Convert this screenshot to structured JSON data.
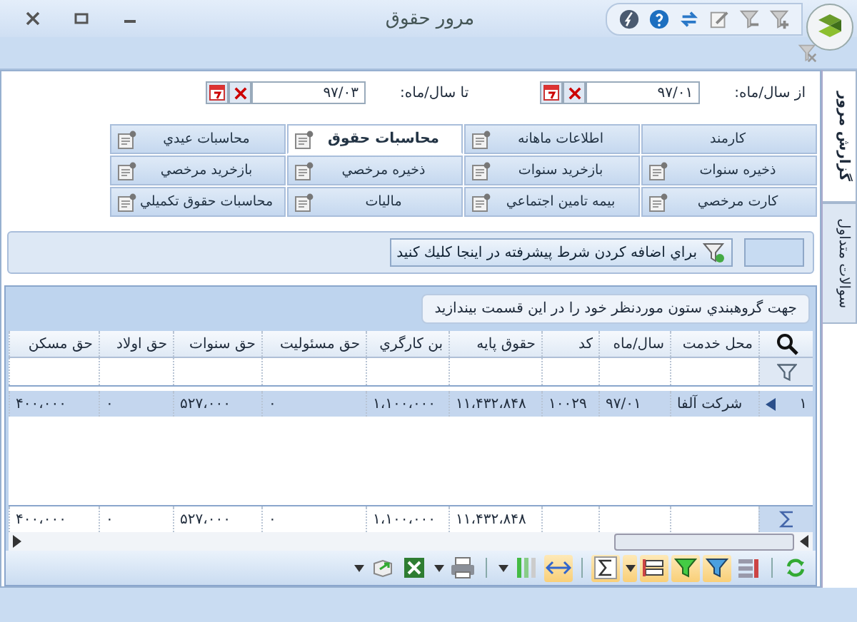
{
  "window": {
    "title": "مرور حقوق"
  },
  "title_toolbar": [
    {
      "kind": "flash"
    },
    {
      "kind": "help"
    },
    {
      "kind": "sync"
    },
    {
      "kind": "edit"
    },
    {
      "kind": "filter-remove"
    },
    {
      "kind": "filter-add"
    }
  ],
  "side_tabs": [
    {
      "label": "گزارش مرور",
      "selected": true
    },
    {
      "label": "سوالات متداول",
      "selected": false
    }
  ],
  "period": {
    "from_label": "از سال/ماه:",
    "from_value": "۹۷/۰۱",
    "to_label": "تا سال/ماه:",
    "to_value": "۹۷/۰۳"
  },
  "report_tabs": [
    {
      "label": "کارمند",
      "selected": false,
      "has_icon": false
    },
    {
      "label": "اطلاعات ماهانه",
      "selected": false,
      "has_icon": true
    },
    {
      "label": "محاسبات حقوق",
      "selected": true,
      "has_icon": true
    },
    {
      "label": "محاسبات عيدي",
      "selected": false,
      "has_icon": true
    },
    {
      "label": "ذخيره سنوات",
      "selected": false,
      "has_icon": true
    },
    {
      "label": "بازخريد سنوات",
      "selected": false,
      "has_icon": true
    },
    {
      "label": "ذخيره مرخصي",
      "selected": false,
      "has_icon": true
    },
    {
      "label": "بازخريد مرخصي",
      "selected": false,
      "has_icon": true
    },
    {
      "label": "کارت مرخصي",
      "selected": false,
      "has_icon": true
    },
    {
      "label": "بيمه تامين اجتماعي",
      "selected": false,
      "has_icon": true
    },
    {
      "label": "ماليات",
      "selected": false,
      "has_icon": true
    },
    {
      "label": "محاسبات حقوق تکميلي",
      "selected": false,
      "has_icon": true
    }
  ],
  "filter_button": "براي اضافه كردن شرط پيشرفته در اينجا كليك كنيد",
  "group_panel": "جهت گروهبندي ستون موردنظر خود را در اين قسمت بيندازيد",
  "table": {
    "columns": [
      "محل خدمت",
      "سال/ماه",
      "کد",
      "حقوق پايه",
      "بن کارگري",
      "حق مسئوليت",
      "حق سنوات",
      "حق اولاد",
      "حق مسکن"
    ],
    "rows": [
      {
        "number": "۱",
        "selected": true,
        "cells": [
          "شرکت آلفا",
          "۹۷/۰۱",
          "۱۰۰۲۹",
          "۱۱،۴۳۲،۸۴۸",
          "۱،۱۰۰،۰۰۰",
          "۰",
          "۵۲۷،۰۰۰",
          "۰",
          "۴۰۰،۰۰۰"
        ]
      }
    ],
    "totals": [
      "۱۱،۴۳۲،۸۴۸",
      "۱،۱۰۰،۰۰۰",
      "۰",
      "۵۲۷،۰۰۰",
      "۰",
      "۴۰۰،۰۰۰"
    ]
  },
  "grid_toolbar": [
    {
      "kind": "refresh",
      "selected": false
    },
    {
      "kind": "separator"
    },
    {
      "kind": "layout",
      "selected": false
    },
    {
      "kind": "filter-edit",
      "selected": true
    },
    {
      "kind": "filter",
      "selected": true
    },
    {
      "kind": "group",
      "selected": true
    },
    {
      "kind": "caret",
      "selected": true
    },
    {
      "kind": "sum",
      "selected": true
    },
    {
      "kind": "separator"
    },
    {
      "kind": "autofit",
      "selected": true
    },
    {
      "kind": "columns",
      "selected": false
    },
    {
      "kind": "caret",
      "selected": false
    },
    {
      "kind": "separator"
    },
    {
      "kind": "print",
      "selected": false
    },
    {
      "kind": "caret",
      "selected": false
    },
    {
      "kind": "excel",
      "selected": false
    },
    {
      "kind": "export",
      "selected": false
    },
    {
      "kind": "caret",
      "selected": false
    }
  ]
}
